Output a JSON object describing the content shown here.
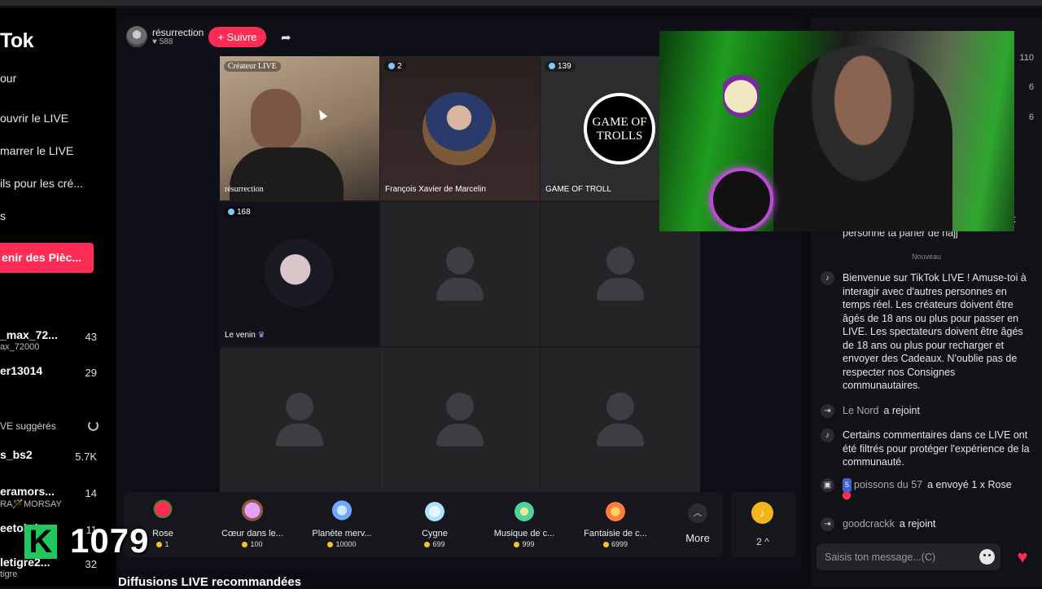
{
  "sidebar": {
    "logo": "Tok",
    "nav": [
      "our",
      "ouvrir le LIVE",
      "marrer le LIVE",
      "ils pour les cré...",
      "s"
    ],
    "coins_button": "enir des Pièc...",
    "accounts": [
      {
        "name": "_max_72...",
        "sub": "ax_72000",
        "count": "43"
      },
      {
        "name": "er13014",
        "sub": "",
        "count": "29"
      }
    ],
    "suggested_title": "VE suggérés",
    "suggested": [
      {
        "name": "s_bs2",
        "sub": "",
        "count": "5.7K"
      },
      {
        "name": "eramors...",
        "sub": "RA🪄MORSAY",
        "count": "14"
      },
      {
        "name": "eetobris",
        "sub": "",
        "count": "11"
      },
      {
        "name": "letigre2...",
        "sub": "tigre",
        "count": "32"
      }
    ]
  },
  "host": {
    "name": "résurrection",
    "likes": "588",
    "follow_label": "+ Suivre"
  },
  "grid": {
    "cells": [
      {
        "badge": "Créateur LIVE",
        "label": "résurrection"
      },
      {
        "badge": "2",
        "label": "François Xavier de Marcelin"
      },
      {
        "badge": "139",
        "label": "GAME OF TROLL"
      },
      {
        "badge": "168",
        "label": "Le venin"
      }
    ],
    "troll_logo": "GAME OF TROLLS"
  },
  "gifts": [
    {
      "name": "Rose",
      "price": "1",
      "icon": "rose-icon",
      "color": "#ff2d55"
    },
    {
      "name": "Cœur dans le...",
      "price": "100",
      "icon": "heart-hands-icon",
      "color": "#e6a0ff"
    },
    {
      "name": "Planète merv...",
      "price": "10000",
      "icon": "planet-icon",
      "color": "#6fa8ff"
    },
    {
      "name": "Cygne",
      "price": "699",
      "icon": "swan-icon",
      "color": "#a8e3ff"
    },
    {
      "name": "Musique de c...",
      "price": "999",
      "icon": "music-icon",
      "color": "#4cd39c"
    },
    {
      "name": "Fantaisie de c...",
      "price": "6999",
      "icon": "fantasy-icon",
      "color": "#ff7b3d"
    }
  ],
  "more_label": "More",
  "coin_count": "2 ^",
  "recommended_title": "Diffusions LIVE recommandées",
  "chat": {
    "rank_numbers": [
      "110",
      "6",
      "6"
    ],
    "prev_msg_tail": "t",
    "prev_msg": "personne ta parler de hajj",
    "divider": "Nouveau",
    "messages": [
      {
        "icon": "tiktok-icon",
        "user": "",
        "text": "Bienvenue sur TikTok LIVE ! Amuse-toi à interagir avec d'autres personnes en temps réel. Les créateurs doivent être âgés de 18 ans ou plus pour passer en LIVE. Les spectateurs doivent être âgés de 18 ans ou plus pour recharger et envoyer des Cadeaux. N'oublie pas de respecter nos Consignes communautaires."
      },
      {
        "icon": "join-icon",
        "user": "Le Nord",
        "text": "a rejoint"
      },
      {
        "icon": "tiktok-icon",
        "user": "",
        "text": "Certains commentaires dans ce LIVE ont été filtrés pour protéger l'expérience de la communauté."
      },
      {
        "icon": "gift-icon",
        "user": "poissons du 57",
        "level": "5",
        "text": "a envoyé 1 x Rose"
      },
      {
        "icon": "join-icon",
        "user": "goodcrackk",
        "text": "a rejoint"
      }
    ],
    "input_placeholder": "Saisis ton message...(C)"
  },
  "overlay": {
    "score_letter": "K",
    "score": "1079"
  }
}
